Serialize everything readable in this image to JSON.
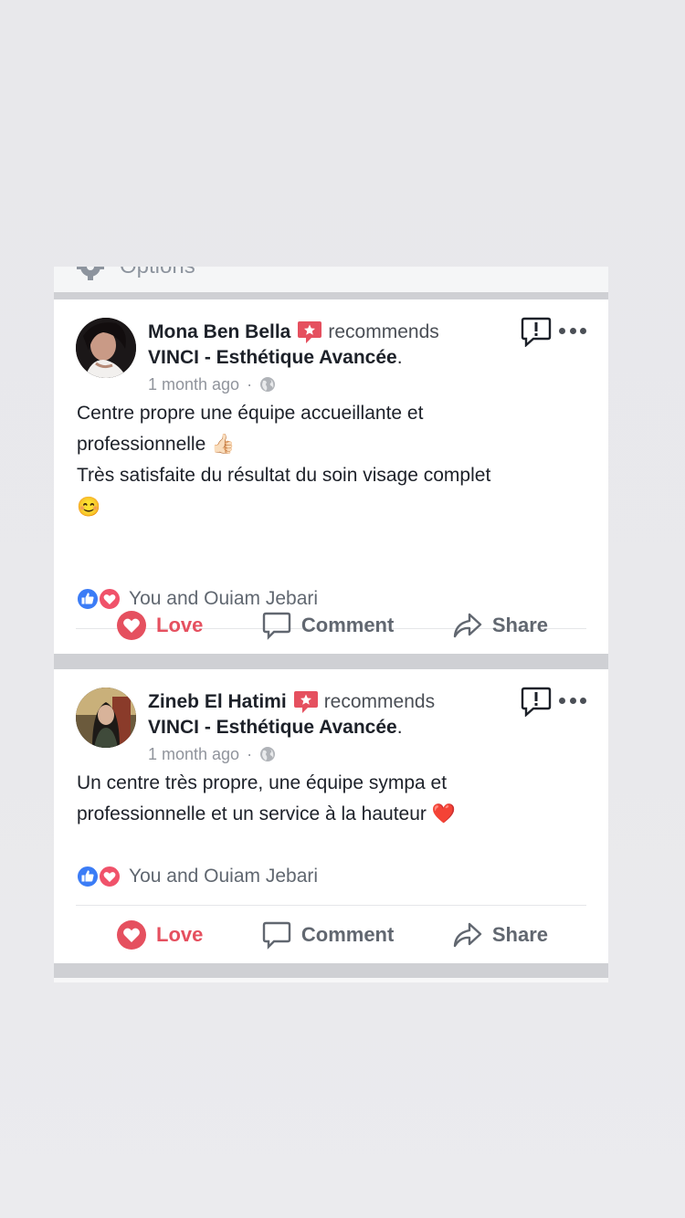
{
  "options_partial_label": "Options",
  "colors": {
    "love": "#e5505f",
    "facebook_blue": "#3b7cf6",
    "text": "#1d2129",
    "muted": "#90949c",
    "panel_gray": "#cfd0d4"
  },
  "reviews": [
    {
      "author": "Mona Ben Bella",
      "verb": "recommends",
      "page": "VINCI - Esthétique Avancée",
      "page_suffix": ".",
      "time": "1 month ago",
      "separator": "·",
      "text_line1": "Centre propre une équipe accueillante et",
      "text_line2": "professionnelle",
      "text_line2_emoji": "👍🏻",
      "text_line3": "Très satisfaite du résultat  du soin visage complet",
      "text_line4_emoji": "😊",
      "reactions_text": "You and Ouiam Jebari",
      "actions": {
        "love": "Love",
        "comment": "Comment",
        "share": "Share"
      }
    },
    {
      "author": "Zineb El Hatimi",
      "verb": "recommends",
      "page": "VINCI - Esthétique Avancée",
      "page_suffix": ".",
      "time": "1 month ago",
      "separator": "·",
      "text_line1": "Un centre très propre, une équipe sympa et",
      "text_line2": "professionnelle et un service à la hauteur",
      "text_line2_emoji": "❤️",
      "reactions_text": "You and Ouiam Jebari",
      "actions": {
        "love": "Love",
        "comment": "Comment",
        "share": "Share"
      }
    }
  ],
  "icons": {
    "options": "gear-icon",
    "recommend_badge": "recommend-badge-icon",
    "report": "report-flag-icon",
    "more": "more-options-icon",
    "privacy": "globe-icon",
    "like_reaction": "like-reaction-icon",
    "love_reaction": "love-reaction-icon",
    "love_action": "heart-icon",
    "comment_action": "comment-bubble-icon",
    "share_action": "share-arrow-icon"
  }
}
